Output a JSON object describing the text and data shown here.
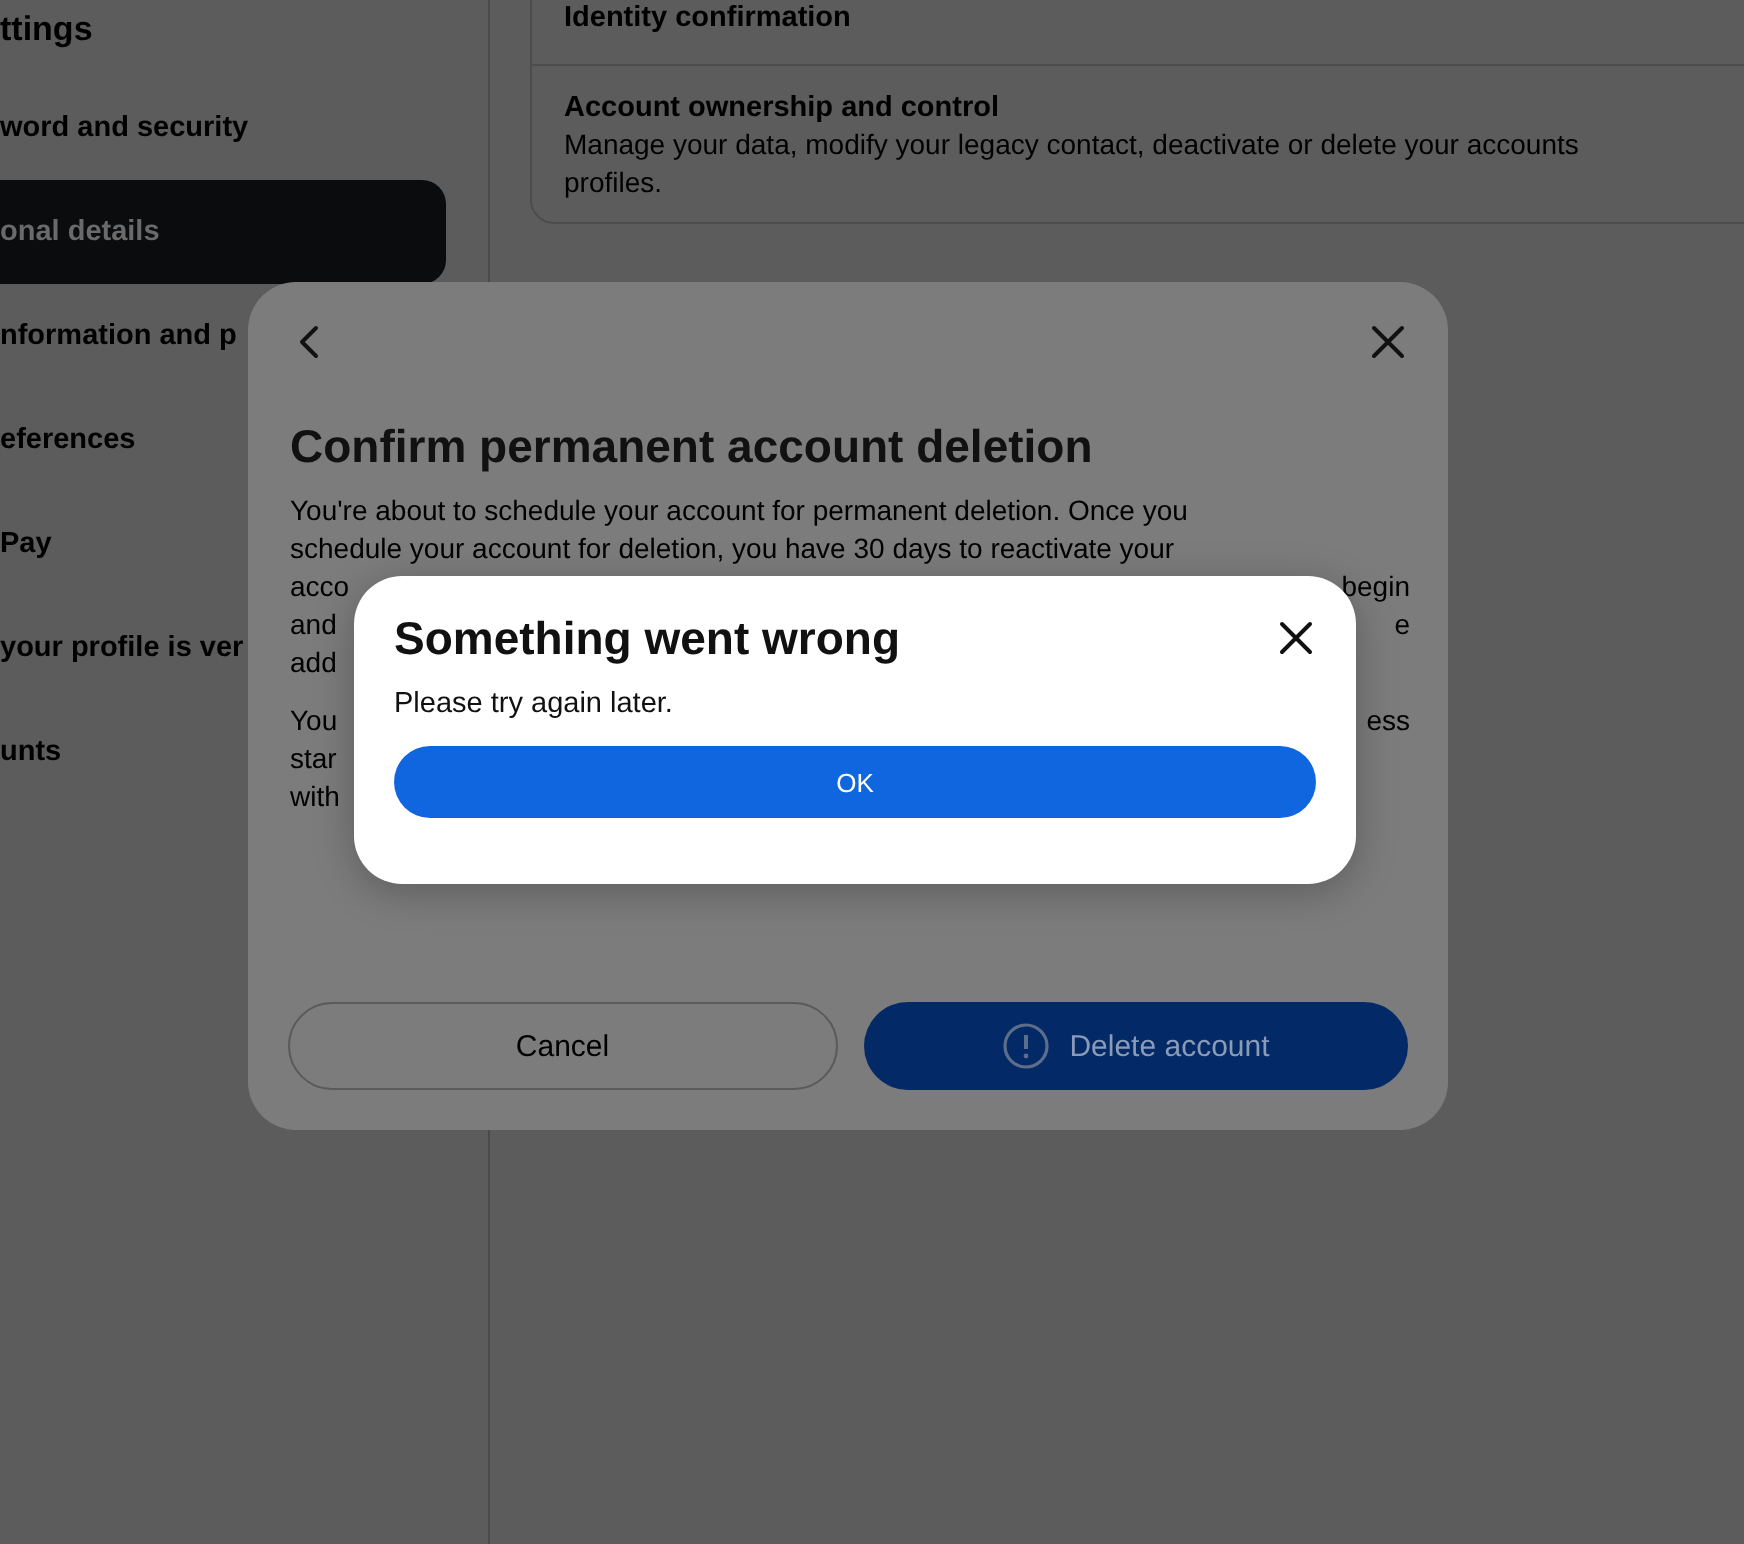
{
  "sidebar": {
    "title": "ttings",
    "items": [
      {
        "label": "word and security",
        "selected": false
      },
      {
        "label": "onal details",
        "selected": true
      },
      {
        "label": "nformation and p",
        "selected": false
      },
      {
        "label": "eferences",
        "selected": false
      },
      {
        "label": "Pay",
        "selected": false
      },
      {
        "label": "your profile is ver",
        "selected": false
      },
      {
        "label": "unts",
        "selected": false
      }
    ]
  },
  "content": {
    "sections": [
      {
        "title": "Identity confirmation"
      },
      {
        "title": "Account ownership and control",
        "description": [
          "Manage your data, modify your legacy contact, deactivate or delete your accounts",
          "profiles."
        ]
      }
    ]
  },
  "dialog": {
    "title": "Confirm permanent account deletion",
    "paragraphs": [
      [
        {
          "left": "You're about to schedule your account for permanent deletion. Once you"
        },
        {
          "left": "schedule your account for deletion, you have 30 days to reactivate your"
        },
        {
          "left": "acco",
          "right": "begin"
        },
        {
          "left": "and",
          "right": "e"
        },
        {
          "left": "add"
        }
      ],
      [
        {
          "left": "You",
          "right": "ess"
        },
        {
          "left": "star"
        },
        {
          "left": "with"
        }
      ]
    ],
    "cancel_button": "Cancel",
    "delete_button": "Delete account"
  },
  "alert": {
    "title": "Something went wrong",
    "message": "Please try again later.",
    "ok_button": "OK"
  }
}
